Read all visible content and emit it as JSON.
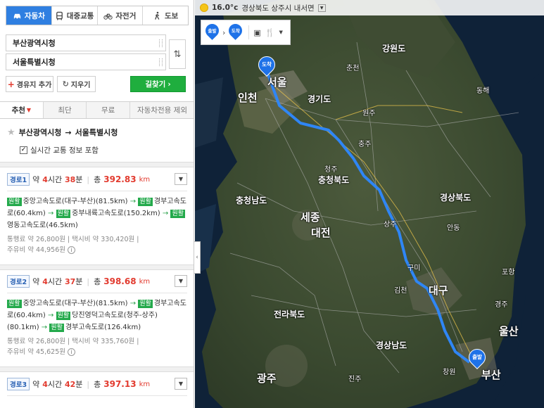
{
  "modes": [
    {
      "label": "자동차",
      "icon": "car-icon",
      "active": true
    },
    {
      "label": "대중교통",
      "icon": "bus-icon",
      "active": false
    },
    {
      "label": "자전거",
      "icon": "bicycle-icon",
      "active": false
    },
    {
      "label": "도보",
      "icon": "walk-icon",
      "active": false
    }
  ],
  "origin": "부산광역시청",
  "destination": "서울특별시청",
  "buttons": {
    "add_waypoint": "경유지 추가",
    "clear": "지우기",
    "find": "길찾기"
  },
  "tabs": [
    "추천",
    "최단",
    "무료",
    "자동차전용 제외"
  ],
  "summary": {
    "from": "부산광역시청",
    "arrow": "→",
    "to": "서울특별시청"
  },
  "realtime_label": "실시간 교통 정보 포함",
  "routes": [
    {
      "badge": "경로1",
      "approx": "약",
      "hours": "4",
      "hours_unit": "시간",
      "minutes": "38",
      "minutes_unit": "분",
      "total_label": "총",
      "distance": "392.83",
      "distance_unit": "km",
      "segments": [
        "중앙고속도로(대구-부산)(81.5km)",
        "경부고속도로(60.4km)",
        "중부내륙고속도로(150.2km)",
        "영동고속도로(46.5km)"
      ],
      "toll": "통행료 약 26,800원",
      "taxi": "택시비 약 330,420원",
      "fuel": "주유비 약 44,956원"
    },
    {
      "badge": "경로2",
      "approx": "약",
      "hours": "4",
      "hours_unit": "시간",
      "minutes": "37",
      "minutes_unit": "분",
      "total_label": "총",
      "distance": "398.68",
      "distance_unit": "km",
      "segments": [
        "중앙고속도로(대구-부산)(81.5km)",
        "경부고속도로(60.4km)",
        "당진영덕고속도로(청주-상주)(80.1km)",
        "경부고속도로(126.4km)"
      ],
      "toll": "통행료 약 26,800원",
      "taxi": "택시비 약 335,760원",
      "fuel": "주유비 약 45,625원"
    },
    {
      "badge": "경로3",
      "approx": "약",
      "hours": "4",
      "hours_unit": "시간",
      "minutes": "42",
      "minutes_unit": "분",
      "total_label": "총",
      "distance": "397.13",
      "distance_unit": "km"
    }
  ],
  "highway_badge": "원활",
  "weather": {
    "temp": "16.0°c",
    "location": "경상북도 상주시 내서면"
  },
  "pins": {
    "start": "출발",
    "end": "도착"
  },
  "map_labels": {
    "seoul": "서울",
    "incheon": "인천",
    "gangwon": "강원도",
    "gyeonggi": "경기도",
    "chungbuk": "충청북도",
    "chungnam": "충청남도",
    "sejong": "세종",
    "daejeon": "대전",
    "jeonbuk": "전라북도",
    "gyeongbuk": "경상북도",
    "gyeongnam": "경상남도",
    "daegu": "대구",
    "busan": "부산",
    "ulsan": "울산",
    "gwangju": "광주",
    "donghae": "동해",
    "pohang": "포항",
    "andong": "안동",
    "gimcheon": "김천",
    "cheongju": "청주",
    "wonju": "원주",
    "chuncheon": "춘천",
    "chungju": "충주",
    "sangju": "상주",
    "gumi": "구미",
    "jinju": "진주",
    "changwon": "창원",
    "gyeongju": "경주"
  }
}
